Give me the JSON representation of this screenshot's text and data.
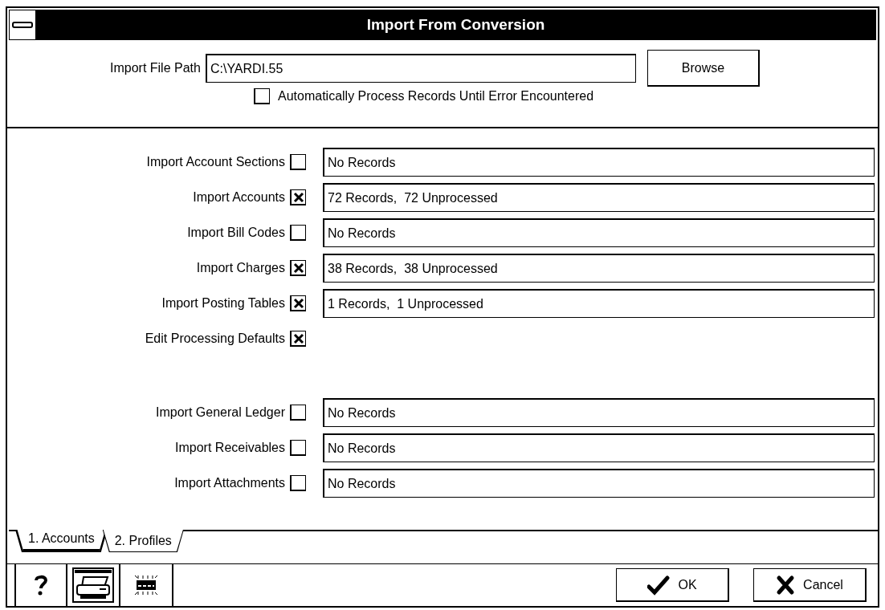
{
  "window": {
    "title": "Import From Conversion"
  },
  "file_path": {
    "label": "Import File Path",
    "value": "C:\\YARDI.55",
    "browse_button": {
      "label": "Browse"
    }
  },
  "auto_process": {
    "label": "Automatically Process Records Until Error Encountered",
    "checked": false
  },
  "sections": [
    {
      "rows": [
        {
          "kind": "status",
          "label": "Import Account Sections",
          "checked": false,
          "status": "No Records"
        },
        {
          "kind": "status",
          "label": "Import Accounts",
          "checked": true,
          "status": "72 Records,  72 Unprocessed"
        },
        {
          "kind": "status",
          "label": "Import Bill Codes",
          "checked": false,
          "status": "No Records"
        },
        {
          "kind": "status",
          "label": "Import Charges",
          "checked": true,
          "status": "38 Records,  38 Unprocessed"
        },
        {
          "kind": "status",
          "label": "Import Posting Tables",
          "checked": true,
          "status": "1 Records,  1 Unprocessed"
        },
        {
          "kind": "checkbox",
          "label": "Edit Processing Defaults",
          "checked": true
        }
      ]
    },
    {
      "rows": [
        {
          "kind": "status",
          "label": "Import General Ledger",
          "checked": false,
          "status": "No Records"
        },
        {
          "kind": "status",
          "label": "Import Receivables",
          "checked": false,
          "status": "No Records"
        },
        {
          "kind": "status",
          "label": "Import Attachments",
          "checked": false,
          "status": "No Records"
        }
      ]
    }
  ],
  "tabs": [
    {
      "label": "1. Accounts",
      "selected": true
    },
    {
      "label": "2. Profiles",
      "selected": false
    }
  ],
  "buttons": [
    {
      "kind": "ok",
      "label": "OK"
    },
    {
      "kind": "cancel",
      "label": "Cancel"
    }
  ]
}
